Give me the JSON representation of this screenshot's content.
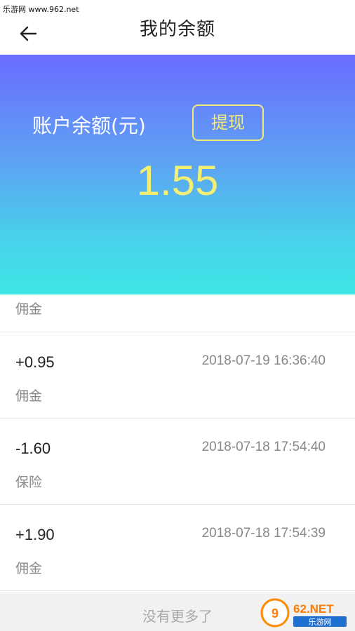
{
  "status_bar": {
    "watermark": "乐游网 www.962.net"
  },
  "nav": {
    "title": "我的余额"
  },
  "balance": {
    "label": "账户余额(元)",
    "withdraw_label": "提现",
    "amount": "1.55"
  },
  "transactions": {
    "partial": {
      "type": "佣金"
    },
    "items": [
      {
        "amount": "+0.95",
        "time": "2018-07-19 16:36:40",
        "type": "佣金"
      },
      {
        "amount": "-1.60",
        "time": "2018-07-18 17:54:40",
        "type": "保险"
      },
      {
        "amount": "+1.90",
        "time": "2018-07-18 17:54:39",
        "type": "佣金"
      }
    ]
  },
  "footer": {
    "no_more": "没有更多了"
  },
  "logo": {
    "brand": "962.NET",
    "sub": "乐游网"
  },
  "colors": {
    "gradient_top": "#6a6cff",
    "gradient_bottom": "#3fe6e6",
    "amount_yellow": "#f3ef73"
  }
}
